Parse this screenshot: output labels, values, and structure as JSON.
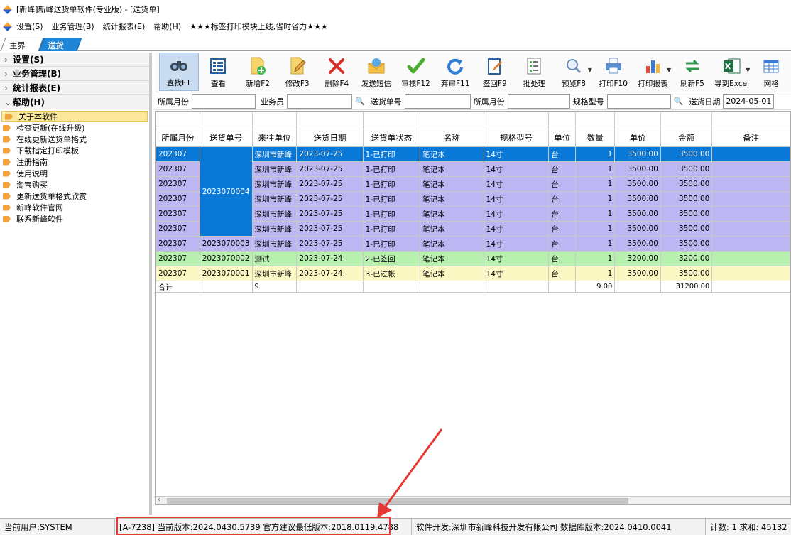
{
  "window": {
    "title": "[新峰]新峰送货单软件(专业版) - [送货单]"
  },
  "menu": {
    "items": [
      "设置(S)",
      "业务管理(B)",
      "统计报表(E)",
      "帮助(H)"
    ],
    "slogan": "★★★标签打印模块上线,省时省力★★★"
  },
  "tabs": {
    "main": "主界面",
    "active": "送货单"
  },
  "sidebar": {
    "sections": [
      "设置(S)",
      "业务管理(B)",
      "统计报表(E)",
      "帮助(H)"
    ],
    "help_items": [
      "关于本软件",
      "检查更新(在线升级)",
      "在线更新送货单格式",
      "下载指定打印模板",
      "注册指南",
      "使用说明",
      "淘宝购买",
      "更新送货单格式欣赏",
      "新峰软件官网",
      "联系新峰软件"
    ]
  },
  "toolbar": {
    "buttons": [
      "查找F1",
      "查看",
      "新增F2",
      "修改F3",
      "删除F4",
      "发送短信",
      "审核F12",
      "弃审F11",
      "签回F9",
      "批处理",
      "预览F8",
      "打印F10",
      "打印报表",
      "刷新F5",
      "导到Excel",
      "网格"
    ]
  },
  "filters": {
    "month_label": "所属月份",
    "salesman_label": "业务员",
    "order_no_label": "送货单号",
    "month2_label": "所属月份",
    "spec_label": "规格型号",
    "date_label": "送货日期",
    "date_value": "2024-05-01"
  },
  "grid": {
    "headers": [
      "所属月份",
      "送货单号",
      "来往单位",
      "送货日期",
      "送货单状态",
      "名称",
      "规格型号",
      "单位",
      "数量",
      "单价",
      "金额",
      "备注"
    ],
    "merged_order_no": "2023070004",
    "rows": [
      {
        "month": "202307",
        "order": "",
        "unit_co": "深圳市新峰",
        "date": "2023-07-25",
        "status": "1-已打印",
        "name": "笔记本",
        "spec": "14寸",
        "unit": "台",
        "qty": "1",
        "price": "3500.00",
        "amount": "3500.00",
        "note": ""
      },
      {
        "month": "202307",
        "order": "",
        "unit_co": "深圳市新峰",
        "date": "2023-07-25",
        "status": "1-已打印",
        "name": "笔记本",
        "spec": "14寸",
        "unit": "台",
        "qty": "1",
        "price": "3500.00",
        "amount": "3500.00",
        "note": ""
      },
      {
        "month": "202307",
        "order": "",
        "unit_co": "深圳市新峰",
        "date": "2023-07-25",
        "status": "1-已打印",
        "name": "笔记本",
        "spec": "14寸",
        "unit": "台",
        "qty": "1",
        "price": "3500.00",
        "amount": "3500.00",
        "note": ""
      },
      {
        "month": "202307",
        "order": "",
        "unit_co": "深圳市新峰",
        "date": "2023-07-25",
        "status": "1-已打印",
        "name": "笔记本",
        "spec": "14寸",
        "unit": "台",
        "qty": "1",
        "price": "3500.00",
        "amount": "3500.00",
        "note": ""
      },
      {
        "month": "202307",
        "order": "",
        "unit_co": "深圳市新峰",
        "date": "2023-07-25",
        "status": "1-已打印",
        "name": "笔记本",
        "spec": "14寸",
        "unit": "台",
        "qty": "1",
        "price": "3500.00",
        "amount": "3500.00",
        "note": ""
      },
      {
        "month": "202307",
        "order": "",
        "unit_co": "深圳市新峰",
        "date": "2023-07-25",
        "status": "1-已打印",
        "name": "笔记本",
        "spec": "14寸",
        "unit": "台",
        "qty": "1",
        "price": "3500.00",
        "amount": "3500.00",
        "note": ""
      },
      {
        "month": "202307",
        "order": "2023070003",
        "unit_co": "深圳市新峰",
        "date": "2023-07-25",
        "status": "1-已打印",
        "name": "笔记本",
        "spec": "14寸",
        "unit": "台",
        "qty": "1",
        "price": "3500.00",
        "amount": "3500.00",
        "note": ""
      },
      {
        "month": "202307",
        "order": "2023070002",
        "unit_co": "测试",
        "date": "2023-07-24",
        "status": "2-已签回",
        "name": "笔记本",
        "spec": "14寸",
        "unit": "台",
        "qty": "1",
        "price": "3200.00",
        "amount": "3200.00",
        "note": ""
      },
      {
        "month": "202307",
        "order": "2023070001",
        "unit_co": "深圳市新峰",
        "date": "2023-07-24",
        "status": "3-已过帐",
        "name": "笔记本",
        "spec": "14寸",
        "unit": "台",
        "qty": "1",
        "price": "3500.00",
        "amount": "3500.00",
        "note": ""
      }
    ],
    "summary": {
      "label": "合计",
      "count": "9",
      "qty": "9.00",
      "amount": "31200.00"
    }
  },
  "status": {
    "user": "当前用户:SYSTEM",
    "version": "[A-7238] 当前版本:2024.0430.5739 官方建议最低版本:2018.0119.4788",
    "developer": "软件开发:深圳市新峰科技开发有限公司 数据库版本:2024.0410.0041",
    "stats": "计数: 1 求和: 45132"
  },
  "colors": {
    "selected": "#0a78d7",
    "printed": "#bcb6f3",
    "signed": "#b8f0b0",
    "posted": "#fcf8c3",
    "highlight": "#e53935"
  }
}
